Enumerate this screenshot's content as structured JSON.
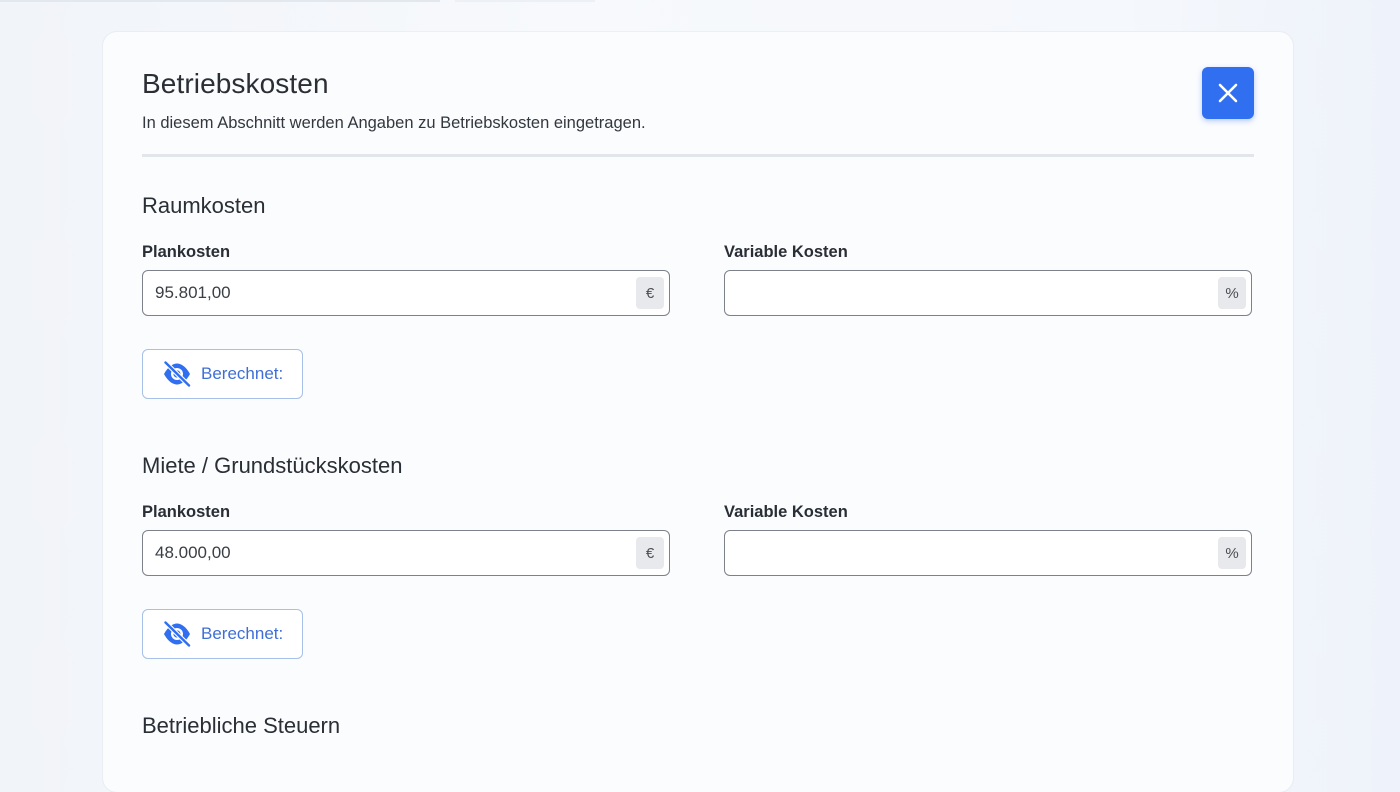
{
  "dialog": {
    "title": "Betriebskosten",
    "subtitle": "In diesem Abschnitt werden Angaben zu Betriebskosten eingetragen.",
    "close_icon": "close-icon"
  },
  "sections": [
    {
      "title": "Raumkosten",
      "plan_label": "Plankosten",
      "plan_value": "95.801,00",
      "plan_unit": "€",
      "var_label": "Variable Kosten",
      "var_value": "",
      "var_unit": "%",
      "calc_label": "Berechnet:",
      "calc_icon": "eye-off-icon"
    },
    {
      "title": "Miete / Grundstückskosten",
      "plan_label": "Plankosten",
      "plan_value": "48.000,00",
      "plan_unit": "€",
      "var_label": "Variable Kosten",
      "var_value": "",
      "var_unit": "%",
      "calc_label": "Berechnet:",
      "calc_icon": "eye-off-icon"
    },
    {
      "title": "Betriebliche Steuern"
    }
  ],
  "colors": {
    "accent": "#2f6ff0",
    "calc_text": "#3f6fd6",
    "calc_border": "#a6c0e8"
  }
}
